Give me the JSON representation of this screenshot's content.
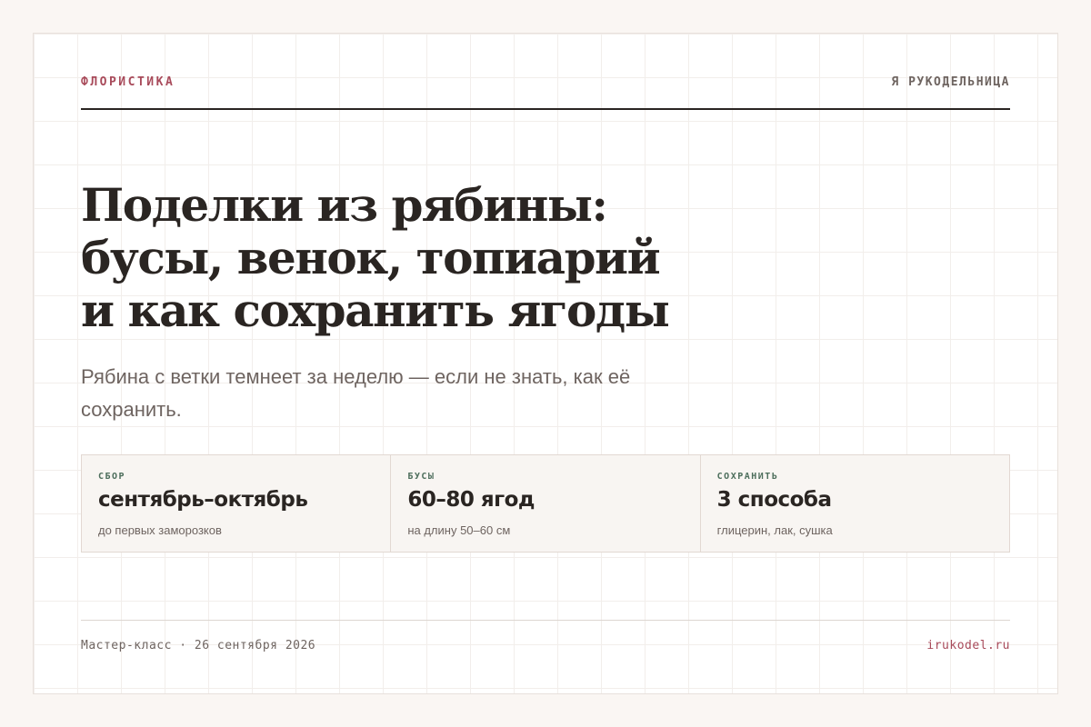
{
  "header": {
    "category": "ФЛОРИСТИКА",
    "brand": "Я РУКОДЕЛЬНИЦА"
  },
  "article": {
    "title_lines": [
      "Поделки из рябины:",
      "бусы, венок, топиарий",
      "и как сохранить ягоды"
    ],
    "subtitle": "Рябина с ветки темнеет за неделю — если не знать, как её сохранить."
  },
  "stats": [
    {
      "label": "СБОР",
      "value": "сентябрь–октябрь",
      "note": "до первых заморозков"
    },
    {
      "label": "БУСЫ",
      "value": "60–80 ягод",
      "note": "на длину 50–60 см"
    },
    {
      "label": "СОХРАНИТЬ",
      "value": "3 способа",
      "note": "глицерин, лак, сушка"
    }
  ],
  "footer": {
    "left": "Мастер-класс · 26 сентября 2026",
    "right": "irukodel.ru"
  },
  "colors": {
    "accent": "#a84a5a",
    "stat_label": "#4d6e5c",
    "text": "#2a2522",
    "muted": "#6e6460"
  }
}
